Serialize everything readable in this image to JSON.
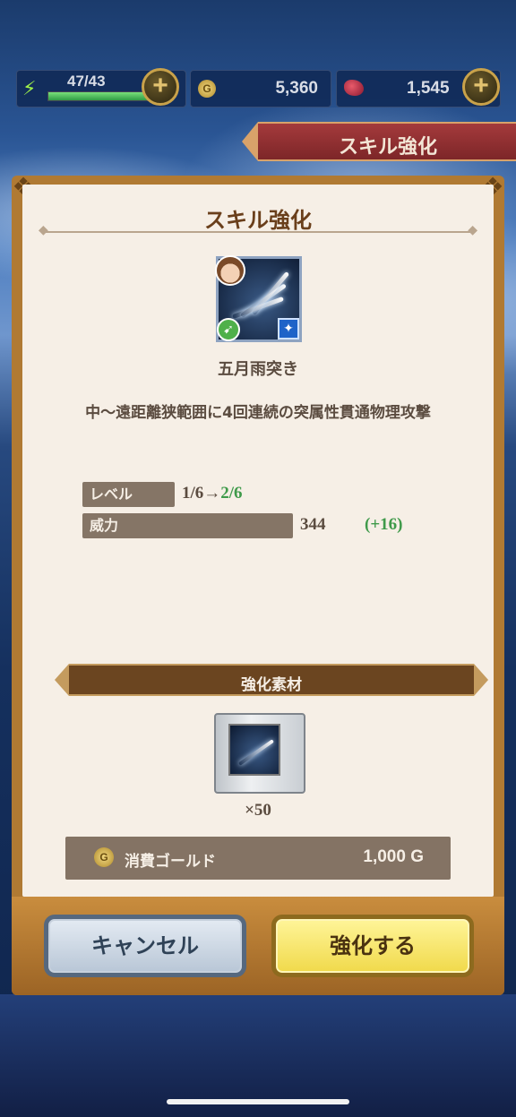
{
  "resources": {
    "stamina_text": "47/43",
    "stamina_fraction": 1.0,
    "gold": "5,360",
    "gems": "1,545"
  },
  "header": {
    "title": "スキル強化"
  },
  "dialog": {
    "title": "スキル強化",
    "skill": {
      "name": "五月雨突き",
      "description": "中〜遠距離狭範囲に4回連続の突属性貫通物理攻撃"
    },
    "stats": {
      "level_label": "レベル",
      "level_current": "1/6→",
      "level_next": "2/6",
      "power_label": "威力",
      "power_value": "344",
      "power_increase": "(+16)"
    },
    "materials": {
      "title": "強化素材",
      "quantity": "×50"
    },
    "cost": {
      "label": "消費ゴールド",
      "value": "1,000 G"
    },
    "buttons": {
      "cancel": "キャンセル",
      "upgrade": "強化する"
    }
  },
  "colors": {
    "accent_green": "#3f9a4a",
    "dialog_bg": "#f6efe6",
    "frame": "#b07a33",
    "upgrade_button": "#f0d94a",
    "cancel_button": "#b8c6d6"
  },
  "icons": [
    "bolt-icon",
    "plus-icon",
    "gold-coin-icon",
    "gem-icon",
    "ornament-corner-icon",
    "pierce-type-icon",
    "element-icon"
  ]
}
